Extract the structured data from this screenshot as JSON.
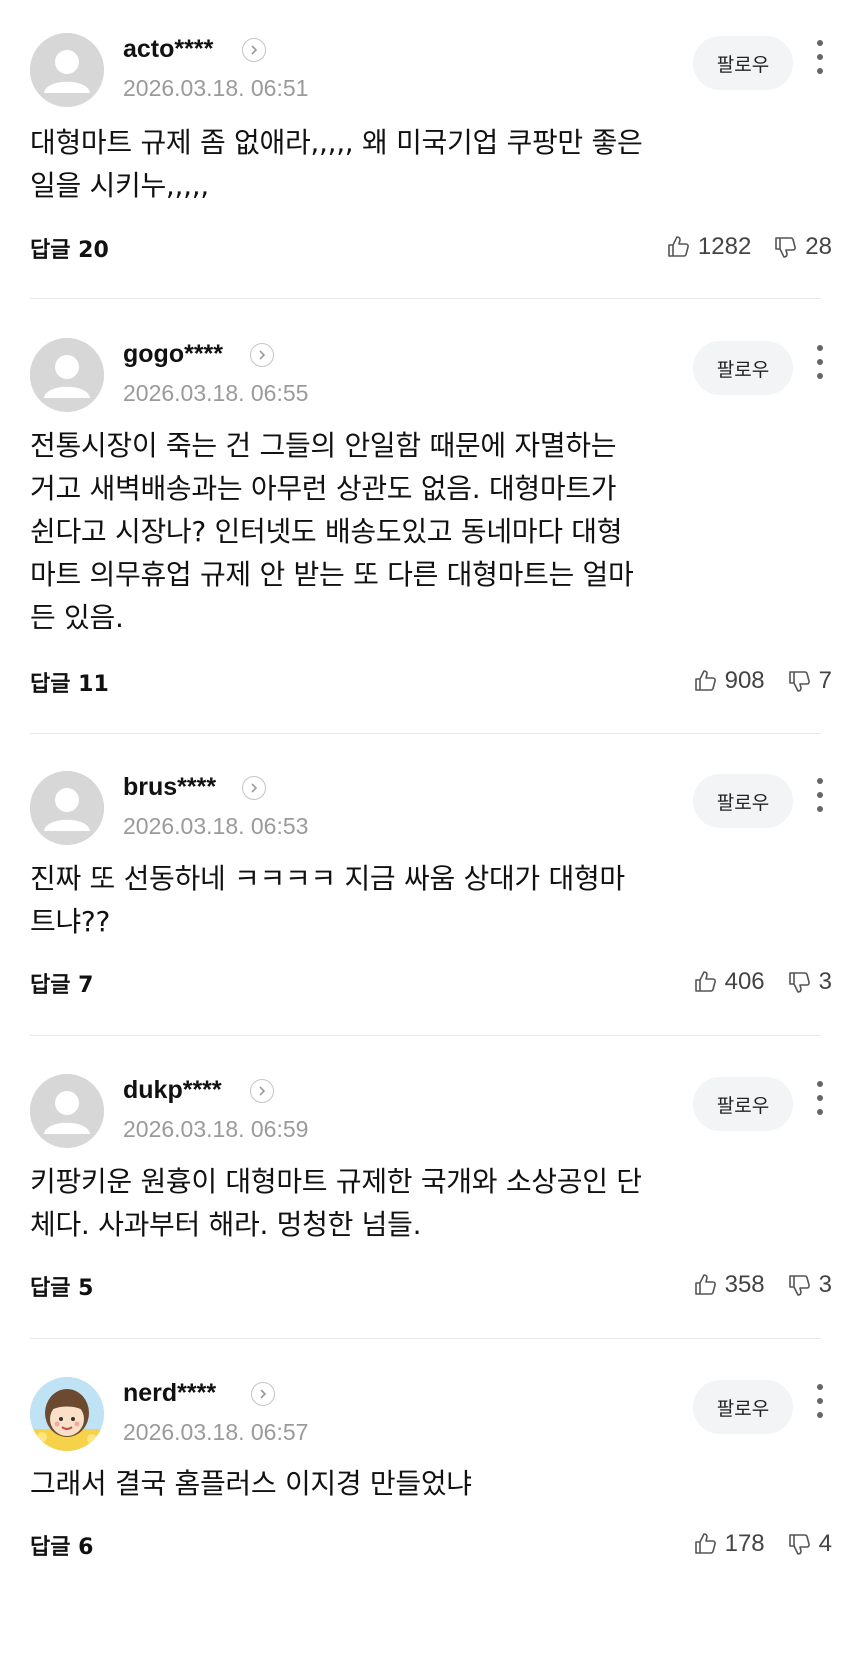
{
  "follow_label": "팔로우",
  "comments": [
    {
      "username": "acto****",
      "timestamp": "2026.03.18. 06:51",
      "lines": [
        "대형마트 규제 좀 없애라,,,,, 왜 미국기업 쿠팡만 좋은",
        "일을 시키누,,,,,"
      ],
      "replies": "답글 20",
      "likes": "1282",
      "dislikes": "28",
      "avatar": "default-avatar-icon"
    },
    {
      "username": "gogo****",
      "timestamp": "2026.03.18. 06:55",
      "lines": [
        "전통시장이 죽는 건 그들의 안일함 때문에 자멸하는",
        "거고 새벽배송과는 아무런 상관도 없음. 대형마트가",
        "쉰다고 시장나? 인터넷도 배송도있고 동네마다 대형",
        "마트 의무휴업 규제 안 받는 또 다른 대형마트는 얼마",
        "든 있음."
      ],
      "replies": "답글 11",
      "likes": "908",
      "dislikes": "7",
      "avatar": "default-avatar-icon"
    },
    {
      "username": "brus****",
      "timestamp": "2026.03.18. 06:53",
      "lines": [
        "진짜 또 선동하네 ㅋㅋㅋㅋ 지금 싸움 상대가 대형마",
        "트냐??"
      ],
      "replies": "답글 7",
      "likes": "406",
      "dislikes": "3",
      "avatar": "default-avatar-icon"
    },
    {
      "username": "dukp****",
      "timestamp": "2026.03.18. 06:59",
      "lines": [
        "키팡키운 원흉이 대형마트 규제한 국개와 소상공인 단",
        "체다. 사과부터 해라. 멍청한 넘들."
      ],
      "replies": "답글 5",
      "likes": "358",
      "dislikes": "3",
      "avatar": "default-avatar-icon"
    },
    {
      "username": "nerd****",
      "timestamp": "2026.03.18. 06:57",
      "lines": [
        "그래서 결국 홈플러스 이지경 만들었냐"
      ],
      "replies": "답글 6",
      "likes": "178",
      "dislikes": "4",
      "avatar": "cartoon-face-avatar-icon"
    }
  ]
}
